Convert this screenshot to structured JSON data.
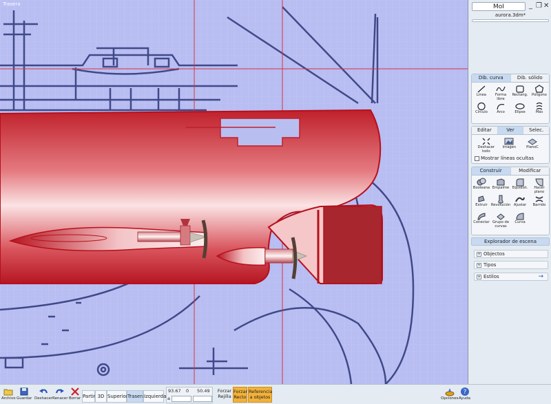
{
  "viewport": {
    "label": "Trasera"
  },
  "panel": {
    "app_name": "MoI",
    "file_name": "aurora.3dm*",
    "curve_tabs": [
      "Dib. curva",
      "Dib. sólido"
    ],
    "curve_tools": [
      {
        "label": "Línea",
        "icon": "line-icon"
      },
      {
        "label": "Forma libre",
        "icon": "freeform-icon"
      },
      {
        "label": "Rectang.",
        "icon": "rectangle-icon"
      },
      {
        "label": "Polígono",
        "icon": "polygon-icon"
      },
      {
        "label": "Círculo",
        "icon": "circle-icon"
      },
      {
        "label": "Arco",
        "icon": "arc-icon"
      },
      {
        "label": "Elipse",
        "icon": "ellipse-icon"
      },
      {
        "label": "Más",
        "icon": "more-icon"
      }
    ],
    "view_tabs": [
      "Editar",
      "Ver",
      "Selec."
    ],
    "view_tools": [
      {
        "label": "Deshacer todo",
        "icon": "reset-view-icon"
      },
      {
        "label": "Imagen",
        "icon": "image-icon"
      },
      {
        "label": "PlanoC",
        "icon": "cplane-icon"
      }
    ],
    "hidden_lines_label": "Mostrar líneas ocultas",
    "build_tabs": [
      "Construir",
      "Modificar"
    ],
    "build_tools": [
      {
        "label": "Booleana",
        "icon": "boolean-icon"
      },
      {
        "label": "Empalme",
        "icon": "fillet-icon"
      },
      {
        "label": "Equidist.",
        "icon": "offset-icon"
      },
      {
        "label": "Hacer plano",
        "icon": "planar-icon"
      },
      {
        "label": "Extruir",
        "icon": "extrude-icon"
      },
      {
        "label": "Revolución",
        "icon": "revolve-icon"
      },
      {
        "label": "Ajustar",
        "icon": "sweep-icon"
      },
      {
        "label": "Barrido",
        "icon": "loft-icon"
      },
      {
        "label": "Conectar",
        "icon": "network-icon"
      },
      {
        "label": "Grupo de curvas",
        "icon": "curve-group-icon"
      },
      {
        "label": "Curva",
        "icon": "curve-icon"
      }
    ],
    "explorer_title": "Explorador de escena",
    "explorer_items": [
      "Objectos",
      "Tipos",
      "Estilos"
    ]
  },
  "toolbar": {
    "buttons": [
      {
        "label": "Archivo",
        "icon": "folder-icon"
      },
      {
        "label": "Guardar",
        "icon": "save-icon"
      },
      {
        "label": "Deshacer",
        "icon": "undo-icon"
      },
      {
        "label": "Renacer",
        "icon": "redo-icon"
      },
      {
        "label": "Borrar",
        "icon": "delete-icon"
      }
    ],
    "views": [
      "Partir",
      "3D",
      "Superior",
      "Trasera",
      "Izquierda"
    ],
    "active_view": "Trasera",
    "coords": {
      "x": "93.67",
      "y": "0",
      "z": "50.49",
      "row2_prefix": "a"
    },
    "snaps": [
      {
        "label": "Forzar Rejilla",
        "on": false
      },
      {
        "label": "Forzar Recto",
        "on": true
      },
      {
        "label": "Referencia a objetos",
        "on": true
      }
    ],
    "options_label": "Opciones",
    "help_label": "Ayuda"
  },
  "colors": {
    "viewport_bg": "#b8bdf2",
    "hull_red": "#c01e2a",
    "blueprint": "#2b3576",
    "accent_tab": "#c7daf2",
    "snap_on": "#f2b13a"
  }
}
